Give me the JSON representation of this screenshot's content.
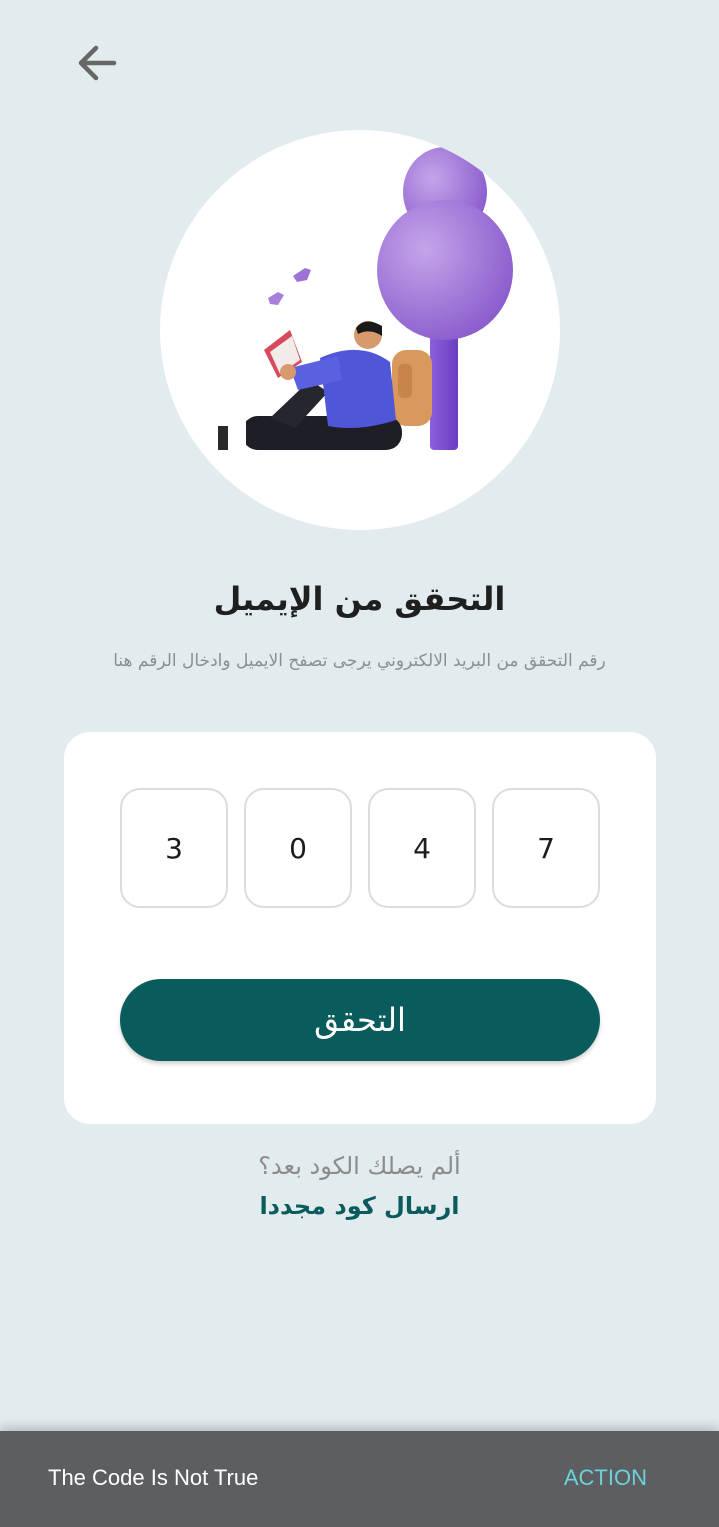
{
  "header": {
    "back_icon": "arrow-left-icon"
  },
  "hero": {
    "illustration": "person-reading-under-tree-illustration"
  },
  "title": "التحقق من الإيميل",
  "subtitle": "رقم التحقق من البريد الالكتروني يرجى تصفح الايميل وادخال الرقم هنا",
  "otp": {
    "digits": [
      "3",
      "0",
      "4",
      "7"
    ]
  },
  "verify_button": {
    "label": "التحقق"
  },
  "resend": {
    "question": "ألم يصلك الكود بعد؟",
    "link": "ارسال كود مجددا"
  },
  "snackbar": {
    "message": "The Code Is Not True",
    "action": "ACTION"
  },
  "colors": {
    "background": "#e2ebee",
    "primary": "#0a5b5c",
    "snackbar": "#5c5e61",
    "snackbar_action": "#6dd1d5"
  }
}
